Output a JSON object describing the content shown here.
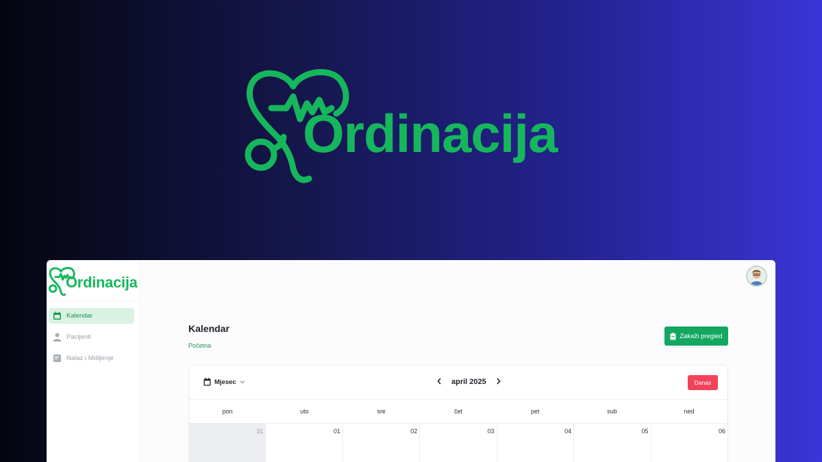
{
  "hero": {
    "brand": "Ordinacija"
  },
  "sidebar": {
    "brand": "Ordinacija",
    "items": [
      {
        "label": "Kalendar",
        "icon": "calendar-icon",
        "active": true
      },
      {
        "label": "Pacijenti",
        "icon": "user-icon",
        "active": false
      },
      {
        "label": "Nalaz i Mišljenje",
        "icon": "document-icon",
        "active": false
      }
    ]
  },
  "header": {
    "title": "Kalendar",
    "breadcrumb": "Početna",
    "book_button": "Zakaži pregled"
  },
  "calendar": {
    "view": "Mjesec",
    "month_label": "april 2025",
    "today_button": "Danas",
    "weekdays": [
      "pon",
      "uto",
      "sre",
      "čet",
      "pet",
      "sub",
      "ned"
    ],
    "first_week": [
      "31",
      "01",
      "02",
      "03",
      "04",
      "05",
      "06"
    ]
  },
  "colors": {
    "brand_green": "#16b75c",
    "button_green": "#12a862",
    "today_red": "#f2435a"
  }
}
